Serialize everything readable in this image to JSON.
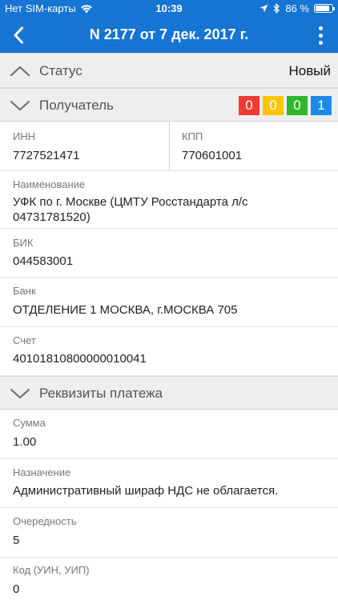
{
  "status_bar": {
    "carrier": "Нет SIM-карты",
    "time": "10:39",
    "battery": "86 %"
  },
  "navbar": {
    "title": "N 2177 от 7 дек. 2017 г."
  },
  "status_section": {
    "label": "Статус",
    "value": "Новый"
  },
  "recipient_section": {
    "label": "Получатель",
    "badges": [
      {
        "value": "0",
        "color": "#ee3b34"
      },
      {
        "value": "0",
        "color": "#f7c600"
      },
      {
        "value": "0",
        "color": "#2fb82b"
      },
      {
        "value": "1",
        "color": "#1e8ae6"
      }
    ]
  },
  "recipient": {
    "inn_label": "ИНН",
    "inn_value": "7727521471",
    "kpp_label": "КПП",
    "kpp_value": "770601001",
    "name_label": "Наименование",
    "name_value_line1": "УФК по г. Москве (ЦМТУ Росстандарта л/с",
    "name_value_line2": "04731781520)",
    "bik_label": "БИК",
    "bik_value": "044583001",
    "bank_label": "Банк",
    "bank_value": "ОТДЕЛЕНИЕ 1 МОСКВА, г.МОСКВА 705",
    "account_label": "Счет",
    "account_value": "40101810800000010041"
  },
  "payment_section": {
    "label": "Реквизиты платежа"
  },
  "payment": {
    "sum_label": "Сумма",
    "sum_value": "1.00",
    "purpose_label": "Назначение",
    "purpose_value": "Административный шираф НДС не облагается.",
    "priority_label": "Очередность",
    "priority_value": "5",
    "code_label": "Код (УИН, УИП)",
    "code_value": "0"
  }
}
